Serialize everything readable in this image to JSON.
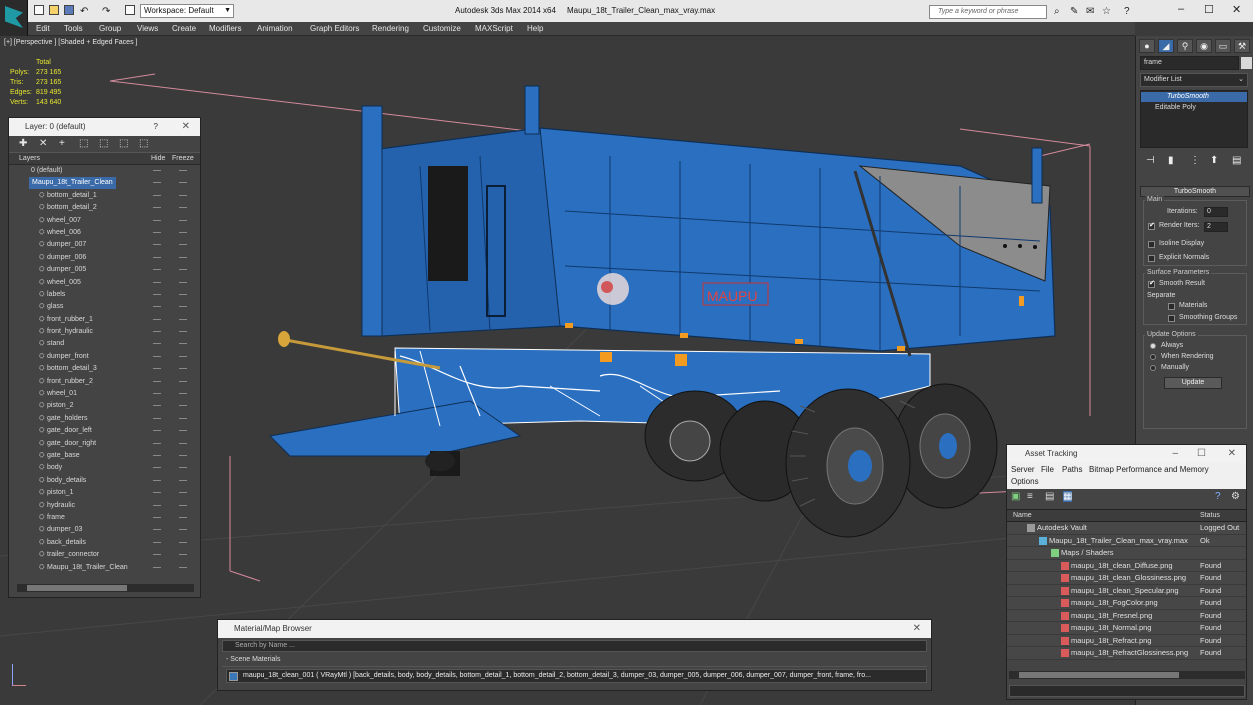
{
  "titlebar": {
    "workspace": "Workspace: Default",
    "app_name": "Autodesk 3ds Max  2014 x64",
    "file_name": "Maupu_18t_Trailer_Clean_max_vray.max",
    "search_placeholder": "Type a keyword or phrase"
  },
  "menu": [
    "Edit",
    "Tools",
    "Group",
    "Views",
    "Create",
    "Modifiers",
    "Animation",
    "Graph Editors",
    "Rendering",
    "Customize",
    "MAXScript",
    "Help"
  ],
  "viewport": {
    "label": "[+] [Perspective ] [Shaded + Edged Faces ]",
    "stats": {
      "header": "Total",
      "rows": [
        {
          "label": "Polys:",
          "value": "273 165"
        },
        {
          "label": "Tris:",
          "value": "273 165"
        },
        {
          "label": "Edges:",
          "value": "819 495"
        },
        {
          "label": "Verts:",
          "value": "143 640"
        }
      ]
    },
    "trailer_brand": "MAUPU",
    "colors": {
      "trailer_blue": "#2a6fc0",
      "wire_white": "#ffffff",
      "bbox_pink": "#e08aa0",
      "stats_yellow": "#e6e630"
    }
  },
  "layer_panel": {
    "title": "Layer: 0 (default)",
    "help": "?",
    "columns": {
      "layers": "Layers",
      "hide": "Hide",
      "freeze": "Freeze"
    },
    "layers": [
      {
        "name": "0 (default)",
        "level": 1
      },
      {
        "name": "Maupu_18t_Trailer_Clean",
        "level": 1,
        "selected": true
      }
    ],
    "objects": [
      "bottom_detail_1",
      "bottom_detail_2",
      "wheel_007",
      "wheel_006",
      "dumper_007",
      "dumper_006",
      "dumper_005",
      "wheel_005",
      "labels",
      "glass",
      "front_rubber_1",
      "front_hydraulic",
      "stand",
      "dumper_front",
      "bottom_detail_3",
      "front_rubber_2",
      "wheel_01",
      "piston_2",
      "gate_holders",
      "gate_door_left",
      "gate_door_right",
      "gate_base",
      "body",
      "body_details",
      "piston_1",
      "hydraulic",
      "frame",
      "dumper_03",
      "back_details",
      "trailer_connector",
      "Maupu_18t_Trailer_Clean"
    ]
  },
  "command_panel": {
    "object_name": "frame",
    "modifier_list": "Modifier List",
    "stack": [
      "TurboSmooth",
      "Editable Poly"
    ],
    "rollout_title": "TurboSmooth",
    "main": {
      "label": "Main",
      "iterations_label": "Iterations:",
      "iterations": "0",
      "render_iters_label": "Render Iters:",
      "render_iters": "2",
      "isoline": "Isoline Display",
      "explicit": "Explicit Normals"
    },
    "surface": {
      "label": "Surface Parameters",
      "smooth_result": "Smooth Result",
      "separate": "Separate",
      "materials": "Materials",
      "smoothing_groups": "Smoothing Groups"
    },
    "update": {
      "label": "Update Options",
      "always": "Always",
      "when_rendering": "When Rendering",
      "manually": "Manually",
      "button": "Update"
    }
  },
  "asset_panel": {
    "title": "Asset Tracking",
    "menu": [
      "Server",
      "File",
      "Paths",
      "Bitmap Performance and Memory",
      "Options"
    ],
    "columns": {
      "name": "Name",
      "status": "Status"
    },
    "rows": [
      {
        "name": "Autodesk Vault",
        "status": "Logged Out ...",
        "indent": 18
      },
      {
        "name": "Maupu_18t_Trailer_Clean_max_vray.max",
        "status": "Ok",
        "indent": 30
      },
      {
        "name": "Maps / Shaders",
        "status": "",
        "indent": 42
      },
      {
        "name": "maupu_18t_clean_Diffuse.png",
        "status": "Found",
        "indent": 52
      },
      {
        "name": "maupu_18t_clean_Glossiness.png",
        "status": "Found",
        "indent": 52
      },
      {
        "name": "maupu_18t_clean_Specular.png",
        "status": "Found",
        "indent": 52
      },
      {
        "name": "maupu_18t_FogColor.png",
        "status": "Found",
        "indent": 52
      },
      {
        "name": "maupu_18t_Fresnel.png",
        "status": "Found",
        "indent": 52
      },
      {
        "name": "maupu_18t_Normal.png",
        "status": "Found",
        "indent": 52
      },
      {
        "name": "maupu_18t_Refract.png",
        "status": "Found",
        "indent": 52
      },
      {
        "name": "maupu_18t_RefractGlossiness.png",
        "status": "Found",
        "indent": 52
      }
    ]
  },
  "material_browser": {
    "title": "Material/Map Browser",
    "search_placeholder": "Search by Name ...",
    "section": "- Scene Materials",
    "material": "maupu_18t_clean_001  ( VRayMtl ) [back_details, body, body_details, bottom_detail_1, bottom_detail_2, bottom_detail_3, dumper_03, dumper_005, dumper_006, dumper_007, dumper_front, frame, fro..."
  }
}
